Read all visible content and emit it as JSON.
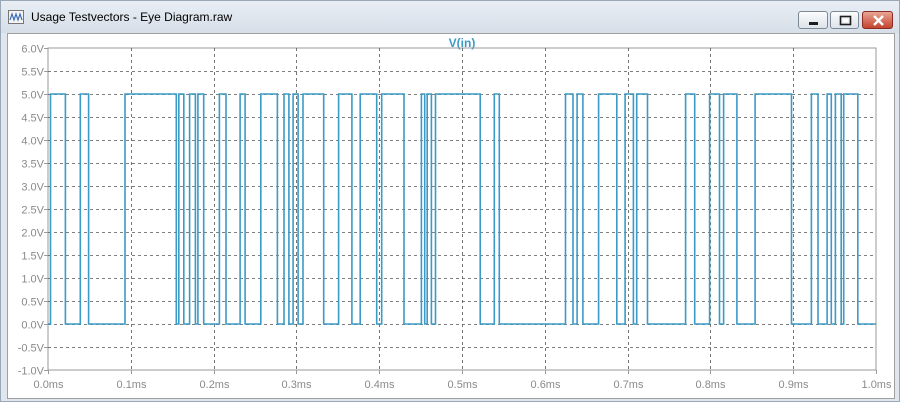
{
  "window": {
    "title": "Usage Testvectors - Eye Diagram.raw",
    "icon": "waveform-viewer-icon",
    "buttons": {
      "minimize": "minimize-icon",
      "maximize": "maximize-icon",
      "close": "close-icon"
    }
  },
  "colors": {
    "trace": "#3b9ac6",
    "grid": "#555555",
    "axis": "#9a9a9a",
    "tick_text": "#8a8a8a"
  },
  "chart_data": {
    "type": "line",
    "title": "V(in)",
    "grid": true,
    "xlim": [
      0,
      1.0
    ],
    "ylim": [
      -1.0,
      6.0
    ],
    "x_ticks": [
      0.0,
      0.1,
      0.2,
      0.3,
      0.4,
      0.5,
      0.6,
      0.7,
      0.8,
      0.9,
      1.0
    ],
    "x_tick_labels": [
      "0.0ms",
      "0.1ms",
      "0.2ms",
      "0.3ms",
      "0.4ms",
      "0.5ms",
      "0.6ms",
      "0.7ms",
      "0.8ms",
      "0.9ms",
      "1.0ms"
    ],
    "y_ticks": [
      6.0,
      5.5,
      5.0,
      4.5,
      4.0,
      3.5,
      3.0,
      2.5,
      2.0,
      1.5,
      1.0,
      0.5,
      0.0,
      -0.5,
      -1.0
    ],
    "y_tick_labels": [
      "6.0V",
      "5.5V",
      "5.0V",
      "4.5V",
      "4.0V",
      "3.5V",
      "3.0V",
      "2.5V",
      "2.0V",
      "1.5V",
      "1.0V",
      "0.5V",
      "0.0V",
      "-0.5V",
      "-1.0V"
    ],
    "series": [
      {
        "name": "V(in)",
        "high_level": 5.0,
        "low_level": 0.0,
        "start_level": 0.0,
        "high_intervals": [
          [
            0.003,
            0.021
          ],
          [
            0.039,
            0.049
          ],
          [
            0.093,
            0.155
          ],
          [
            0.158,
            0.164
          ],
          [
            0.171,
            0.178
          ],
          [
            0.181,
            0.188
          ],
          [
            0.207,
            0.215
          ],
          [
            0.232,
            0.238
          ],
          [
            0.257,
            0.277
          ],
          [
            0.285,
            0.291
          ],
          [
            0.296,
            0.302
          ],
          [
            0.308,
            0.333
          ],
          [
            0.351,
            0.367
          ],
          [
            0.377,
            0.397
          ],
          [
            0.403,
            0.43
          ],
          [
            0.451,
            0.455
          ],
          [
            0.458,
            0.463
          ],
          [
            0.468,
            0.522
          ],
          [
            0.539,
            0.545
          ],
          [
            0.625,
            0.634
          ],
          [
            0.639,
            0.646
          ],
          [
            0.665,
            0.687
          ],
          [
            0.697,
            0.707
          ],
          [
            0.711,
            0.724
          ],
          [
            0.77,
            0.781
          ],
          [
            0.799,
            0.811
          ],
          [
            0.816,
            0.832
          ],
          [
            0.854,
            0.898
          ],
          [
            0.922,
            0.93
          ],
          [
            0.941,
            0.946
          ],
          [
            0.951,
            0.958
          ],
          [
            0.961,
            0.978
          ]
        ],
        "end": 1.0
      }
    ]
  }
}
